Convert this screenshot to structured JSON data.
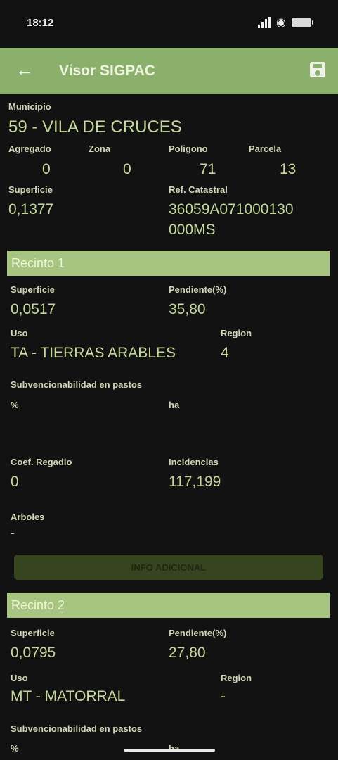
{
  "status": {
    "time": "18:12"
  },
  "app_bar": {
    "title": "Visor SIGPAC"
  },
  "parcel": {
    "municipio_label": "Municipio",
    "municipio_value": "59 - VILA DE CRUCES",
    "agregado_label": "Agregado",
    "agregado_value": "0",
    "zona_label": "Zona",
    "zona_value": "0",
    "poligono_label": "Poligono",
    "poligono_value": "71",
    "parcela_label": "Parcela",
    "parcela_value": "13",
    "superficie_label": "Superficie",
    "superficie_value": "0,1377",
    "refcat_label": "Ref. Catastral",
    "refcat_line1": "36059A071000130",
    "refcat_line2": "000MS"
  },
  "recinto1": {
    "title": "Recinto 1",
    "superficie_label": "Superficie",
    "superficie_value": "0,0517",
    "pendiente_label": "Pendiente(%)",
    "pendiente_value": "35,80",
    "uso_label": "Uso",
    "uso_value": "TA - TIERRAS ARABLES",
    "region_label": "Region",
    "region_value": "4",
    "subv_label": "Subvencionabilidad en pastos",
    "subv_pct_label": "%",
    "subv_ha_label": "ha",
    "coef_label": "Coef. Regadio",
    "coef_value": "0",
    "incidencias_label": "Incidencias",
    "incidencias_value": "117,199",
    "arboles_label": "Arboles",
    "arboles_value": "-",
    "info_button": "INFO ADICIONAL"
  },
  "recinto2": {
    "title": "Recinto 2",
    "superficie_label": "Superficie",
    "superficie_value": "0,0795",
    "pendiente_label": "Pendiente(%)",
    "pendiente_value": "27,80",
    "uso_label": "Uso",
    "uso_value": "MT - MATORRAL",
    "region_label": "Region",
    "region_value": "-",
    "subv_label": "Subvencionabilidad en pastos",
    "subv_pct_label": "%",
    "subv_ha_label": "ha"
  },
  "icons": {
    "back": "arrow-left-icon",
    "save": "save-icon",
    "signal": "signal-icon",
    "wifi": "wifi-icon",
    "battery": "battery-icon"
  },
  "colors": {
    "app_bar": "#8bb06b",
    "section_bar": "#a7c481",
    "background": "#121212",
    "button_bg": "#364520"
  }
}
